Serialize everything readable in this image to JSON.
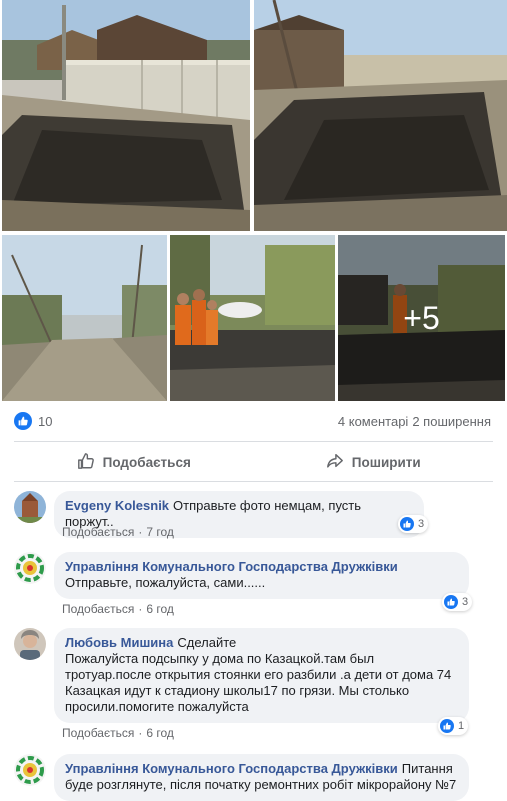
{
  "photos": {
    "more_overlay": "+5"
  },
  "stats": {
    "likes": "10",
    "comments": "4 коментарі",
    "shares": "2 поширення"
  },
  "actions": {
    "like_label": "Подобається",
    "share_label": "Поширити"
  },
  "colors": {
    "accent": "#1877f2",
    "link": "#385898",
    "bubble": "#f0f2f5",
    "muted": "#65676b"
  },
  "comments": [
    {
      "author": "Evgeny Kolesnik",
      "text": "Отправьте фото немцам, пусть поржут..",
      "like_label": "Подобається",
      "time": "7 год",
      "reactions": "3"
    },
    {
      "author": "Управління Комунального Господарства Дружківки",
      "text": "Отправьте, пожалуйста, сами......",
      "like_label": "Подобається",
      "time": "6 год",
      "reactions": "3"
    },
    {
      "author": "Любовь Мишина",
      "text": "Сделайте",
      "text_body": "Пожалуйста подсыпку у дома по Казацкой.там был тротуар.после открытия стоянки его разбили .а дети от дома 74 Казацкая идут к стадиону школы17 по грязи. Мы столько просили.помогите пожалуйста",
      "like_label": "Подобається",
      "time": "6 год",
      "reactions": "1"
    },
    {
      "author": "Управління Комунального Господарства Дружківки",
      "text": "Питання буде розглянуте, після початку ремонтних робіт мікрорайону №7"
    }
  ]
}
